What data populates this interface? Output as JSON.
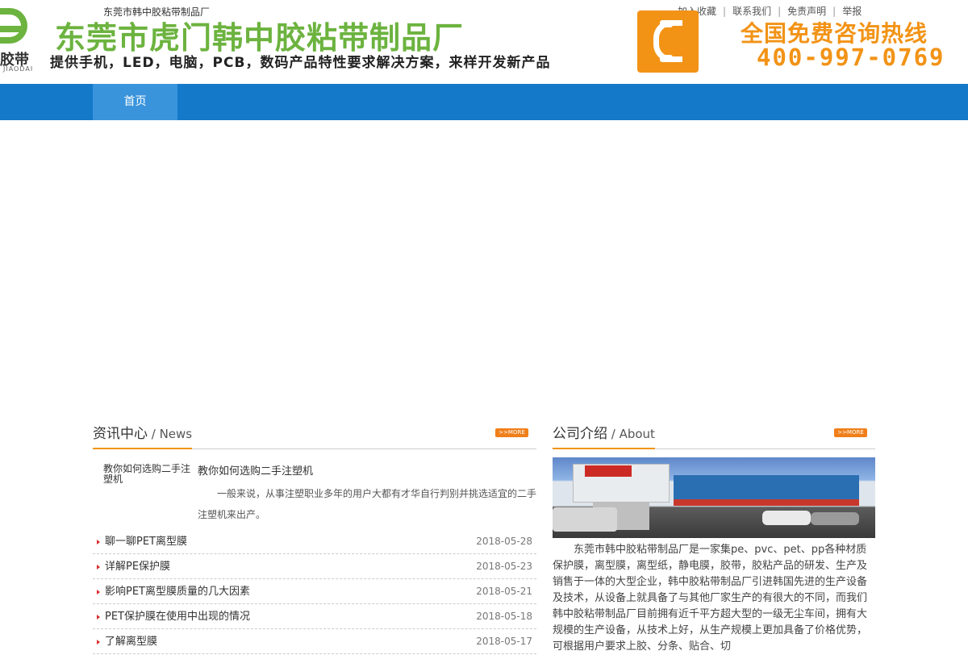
{
  "header": {
    "small_company": "东莞市韩中胶粘带制品厂",
    "logo_text": "胶带",
    "logo_sub": "JIAODAI",
    "title": "东莞市虎门韩中胶粘带制品厂",
    "slogan": "提供手机，LED，电脑，PCB，数码产品特性要求解决方案，来样开发新产品",
    "top_links": [
      "加入收藏",
      "联系我们",
      "免责声明",
      "举报"
    ],
    "hotline_title": "全国免费咨询热线",
    "hotline_number": "400-997-0769"
  },
  "nav": {
    "items": [
      {
        "label": "首页"
      }
    ]
  },
  "news": {
    "title_cn": "资讯中心",
    "title_en": " / News",
    "more": ">>MORE",
    "featured": {
      "thumb_text": "教你如何选购二手注塑机",
      "title": "教你如何选购二手注塑机",
      "desc": "一般来说，从事注塑职业多年的用户大都有才华自行判别并挑选适宜的二手注塑机来出产。"
    },
    "items": [
      {
        "title": "聊一聊PET离型膜",
        "date": "2018-05-28"
      },
      {
        "title": "详解PE保护膜",
        "date": "2018-05-23"
      },
      {
        "title": "影响PET离型膜质量的几大因素",
        "date": "2018-05-21"
      },
      {
        "title": "PET保护膜在使用中出现的情况",
        "date": "2018-05-18"
      },
      {
        "title": "了解离型膜",
        "date": "2018-05-17"
      }
    ]
  },
  "about": {
    "title_cn": "公司介绍",
    "title_en": " / About",
    "more": ">>MORE",
    "text": "东莞市韩中胶粘带制品厂是一家集pe、pvc、pet、pp各种材质保护膜，离型膜，离型纸，静电膜，胶带，胶粘产品的研发、生产及销售于一体的大型企业，韩中胶粘带制品厂引进韩国先进的生产设备及技术，从设备上就具备了与其他厂家生产的有很大的不同，而我们韩中胶粘带制品厂目前拥有近千平方超大型的一级无尘车间，拥有大规模的生产设备，从技术上好，从生产规模上更加具备了价格优势，可根据用户要求上胶、分条、贴合、切"
  },
  "colors": {
    "brand_green": "#6cb33f",
    "accent_orange": "#f29316",
    "nav_blue": "#1479c9",
    "nav_active": "#3a94dc"
  }
}
